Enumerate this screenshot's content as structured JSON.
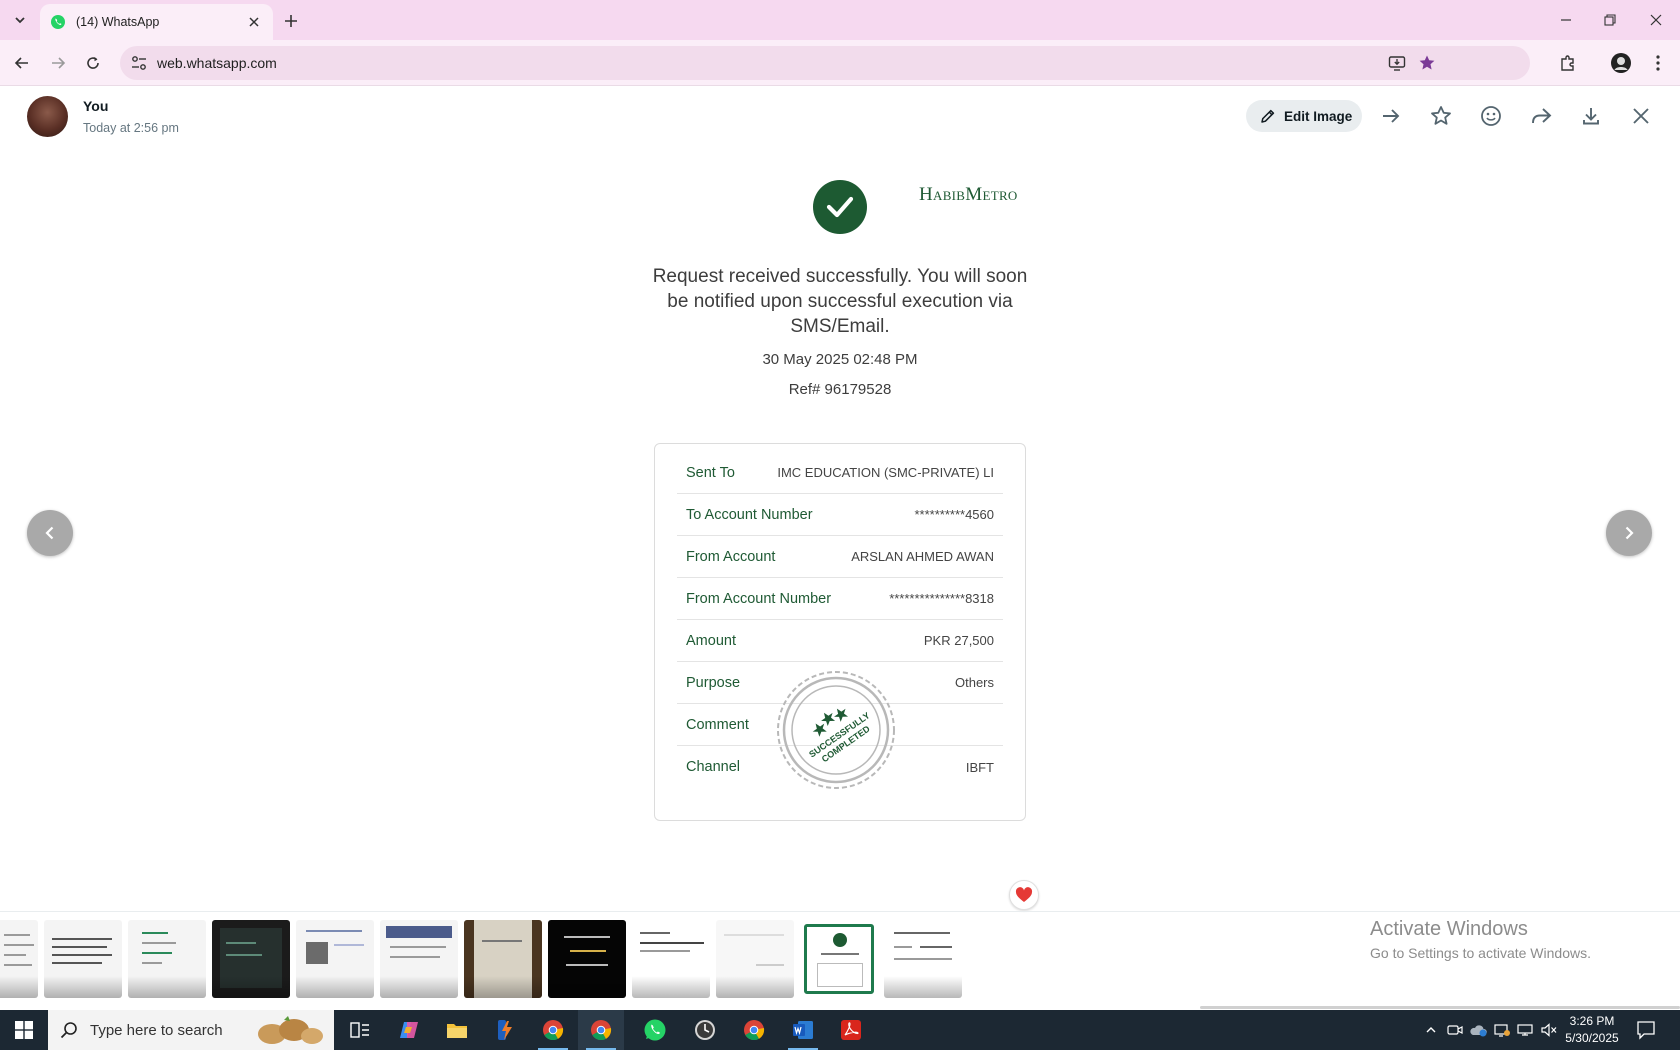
{
  "browser": {
    "tab_title": "(14) WhatsApp",
    "url": "web.whatsapp.com"
  },
  "viewer": {
    "sender_name": "You",
    "timestamp": "Today at 2:56 pm",
    "edit_image_label": "Edit Image"
  },
  "receipt": {
    "bank_logo": "HabibMetro",
    "message": "Request received successfully. You will soon be notified upon successful execution via SMS/Email.",
    "date": "30 May 2025 02:48 PM",
    "ref": "Ref# 96179528",
    "rows": [
      {
        "label": "Sent To",
        "value": "IMC EDUCATION (SMC-PRIVATE) LI"
      },
      {
        "label": "To Account Number",
        "value": "**********4560"
      },
      {
        "label": "From Account",
        "value": "ARSLAN AHMED AWAN"
      },
      {
        "label": "From Account Number",
        "value": "***************8318"
      },
      {
        "label": "Amount",
        "value": "PKR 27,500"
      },
      {
        "label": "Purpose",
        "value": "Others"
      },
      {
        "label": "Comment",
        "value": ""
      },
      {
        "label": "Channel",
        "value": "IBFT"
      }
    ],
    "stamp_text": "SUCCESSFULLY COMPLETED",
    "brand_color": "#1f5a34"
  },
  "watermark": {
    "line1": "Activate Windows",
    "line2": "Go to Settings to activate Windows."
  },
  "taskbar": {
    "search_placeholder": "Type here to search",
    "time": "3:26 PM",
    "date": "5/30/2025"
  },
  "colors": {
    "tabstrip": "#f6d9f0",
    "toolbar": "#fbeef8",
    "whatsapp_green": "#25d366",
    "active_thumb_border": "#1f7a4d"
  }
}
